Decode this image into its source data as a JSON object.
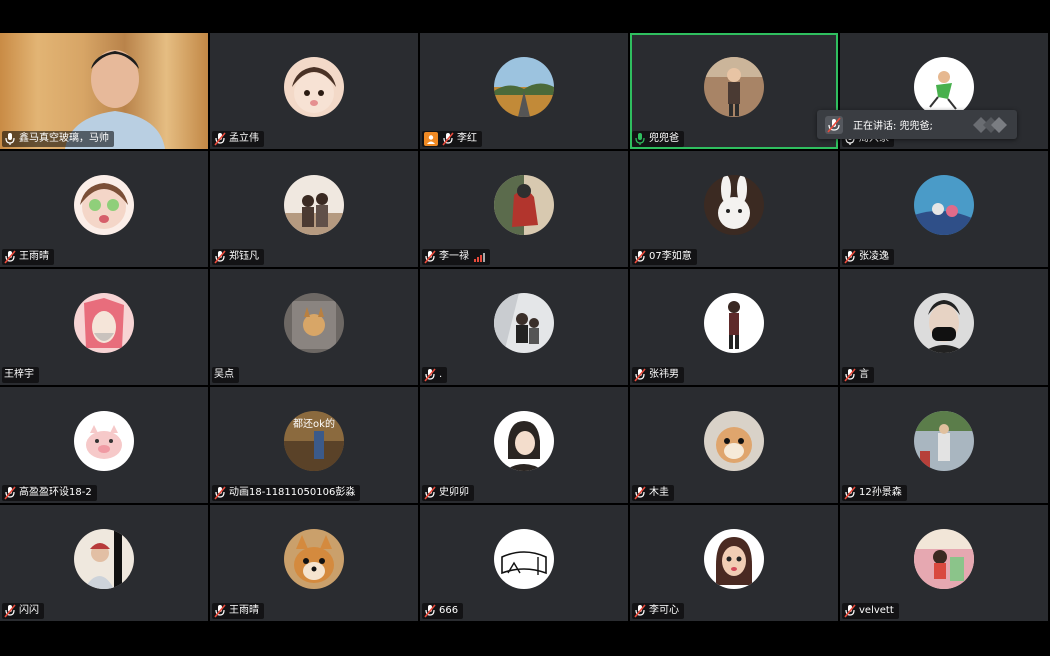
{
  "participants": [
    {
      "name": "鑫马真空玻璃，马帅",
      "muted": false,
      "video": true
    },
    {
      "name": "孟立伟",
      "muted": true
    },
    {
      "name": "李红",
      "muted": true,
      "host": true
    },
    {
      "name": "兜兜爸",
      "muted": false,
      "active": true
    },
    {
      "name": "周兴家",
      "muted": false
    },
    {
      "name": "王雨晴",
      "muted": true
    },
    {
      "name": "郑钰凡",
      "muted": true
    },
    {
      "name": "李一禄",
      "muted": true,
      "signal": true
    },
    {
      "name": "07李如意",
      "muted": true
    },
    {
      "name": "张凌逸",
      "muted": true
    },
    {
      "name": "王梓宇",
      "muted": false,
      "noicon": true
    },
    {
      "name": "吴点",
      "muted": false,
      "noicon": true
    },
    {
      "name": ".",
      "muted": true
    },
    {
      "name": "张祎男",
      "muted": true
    },
    {
      "name": "言",
      "muted": true
    },
    {
      "name": "高盈盈环设18-2",
      "muted": true
    },
    {
      "name": "动画18-11811050106彭淼",
      "muted": true
    },
    {
      "name": "史卯卯",
      "muted": true
    },
    {
      "name": "木圭",
      "muted": true
    },
    {
      "name": "12孙景森",
      "muted": true
    },
    {
      "name": "闪闪",
      "muted": true
    },
    {
      "name": "王雨晴",
      "muted": true
    },
    {
      "name": "666",
      "muted": true
    },
    {
      "name": "李可心",
      "muted": true
    },
    {
      "name": "velvett",
      "muted": true
    }
  ],
  "avatar_text": "都还ok的",
  "speaking": {
    "label": "正在讲话: 兜兜爸;"
  },
  "colors": {
    "muted": "#e94b3c",
    "active_border": "#2fbf5f",
    "tile": "#2a2c30"
  }
}
